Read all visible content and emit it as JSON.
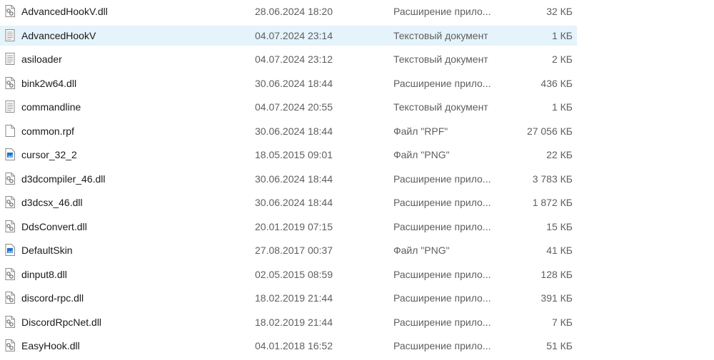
{
  "files": [
    {
      "name": "AdvancedHookV.dll",
      "date": "28.06.2024 18:20",
      "type": "Расширение прило...",
      "size": "32 КБ",
      "icon": "dll-file-icon",
      "selected": false
    },
    {
      "name": "AdvancedHookV",
      "date": "04.07.2024 23:14",
      "type": "Текстовый документ",
      "size": "1 КБ",
      "icon": "text-file-icon",
      "selected": true
    },
    {
      "name": "asiloader",
      "date": "04.07.2024 23:12",
      "type": "Текстовый документ",
      "size": "2 КБ",
      "icon": "text-file-icon",
      "selected": false
    },
    {
      "name": "bink2w64.dll",
      "date": "30.06.2024 18:44",
      "type": "Расширение прило...",
      "size": "436 КБ",
      "icon": "dll-file-icon",
      "selected": false
    },
    {
      "name": "commandline",
      "date": "04.07.2024 20:55",
      "type": "Текстовый документ",
      "size": "1 КБ",
      "icon": "text-file-icon",
      "selected": false
    },
    {
      "name": "common.rpf",
      "date": "30.06.2024 18:44",
      "type": "Файл \"RPF\"",
      "size": "27 056 КБ",
      "icon": "blank-file-icon",
      "selected": false
    },
    {
      "name": "cursor_32_2",
      "date": "18.05.2015 09:01",
      "type": "Файл \"PNG\"",
      "size": "22 КБ",
      "icon": "image-file-icon",
      "selected": false
    },
    {
      "name": "d3dcompiler_46.dll",
      "date": "30.06.2024 18:44",
      "type": "Расширение прило...",
      "size": "3 783 КБ",
      "icon": "dll-file-icon",
      "selected": false
    },
    {
      "name": "d3dcsx_46.dll",
      "date": "30.06.2024 18:44",
      "type": "Расширение прило...",
      "size": "1 872 КБ",
      "icon": "dll-file-icon",
      "selected": false
    },
    {
      "name": "DdsConvert.dll",
      "date": "20.01.2019 07:15",
      "type": "Расширение прило...",
      "size": "15 КБ",
      "icon": "dll-file-icon",
      "selected": false
    },
    {
      "name": "DefaultSkin",
      "date": "27.08.2017 00:37",
      "type": "Файл \"PNG\"",
      "size": "41 КБ",
      "icon": "image-file-icon",
      "selected": false
    },
    {
      "name": "dinput8.dll",
      "date": "02.05.2015 08:59",
      "type": "Расширение прило...",
      "size": "128 КБ",
      "icon": "dll-file-icon",
      "selected": false
    },
    {
      "name": "discord-rpc.dll",
      "date": "18.02.2019 21:44",
      "type": "Расширение прило...",
      "size": "391 КБ",
      "icon": "dll-file-icon",
      "selected": false
    },
    {
      "name": "DiscordRpcNet.dll",
      "date": "18.02.2019 21:44",
      "type": "Расширение прило...",
      "size": "7 КБ",
      "icon": "dll-file-icon",
      "selected": false
    },
    {
      "name": "EasyHook.dll",
      "date": "04.01.2018 16:52",
      "type": "Расширение прило...",
      "size": "51 КБ",
      "icon": "dll-file-icon",
      "selected": false
    }
  ],
  "colors": {
    "selection": "#e5f3fb",
    "secondary_text": "#5f5f5f",
    "image_icon": "#1e73c8"
  }
}
